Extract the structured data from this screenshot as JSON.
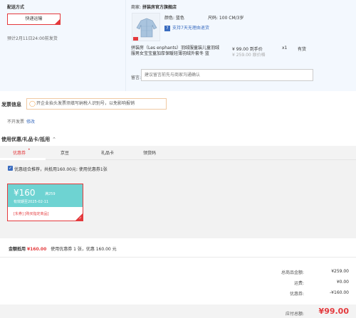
{
  "delivery": {
    "title": "配送方式",
    "method_button": "快递运输",
    "estimate": "预计2月11日24:00前发货"
  },
  "store": {
    "prefix": "商家:",
    "name": "拼装房官方旗舰店"
  },
  "product": {
    "color_label": "颜色: 蓝色",
    "size_label": "尺码: 100 CM/3岁",
    "return_policy": "支持7天无理由退货",
    "name": "拼装房（Les enphants）羽绒服童装儿童羽绒服男女宝宝童加厚保暖轻薄羽绒外套冬 蓝",
    "price": "¥ 99.00 到手价",
    "original_price": "¥ 259.00 原价格",
    "quantity": "x1",
    "stock": "有货",
    "message_label": "留言:",
    "message_placeholder": "建议留言前先与商家沟通确认"
  },
  "invoice": {
    "title": "发票信息",
    "tip": "开企业抬头发票须填写纳税人识别号，以免影响报销",
    "status": "不开发票",
    "edit_link": "修改"
  },
  "coupons": {
    "heading": "使用优惠/礼品卡/抵用",
    "tabs": [
      "优惠券",
      "京豆",
      "礼品卡",
      "领货码"
    ],
    "combo_text": "优惠组合推荐，共抵用160.00元: 使用优惠券1张",
    "card": {
      "amount": "¥160",
      "condition": "满259",
      "expiry": "有效期至2025-02-11",
      "scope": "[东券] [购买指定商品]"
    },
    "summary_prefix": "金额抵用",
    "summary_amount": "¥160.00",
    "summary_suffix": "使用优惠券 1 张，优惠 160.00 元"
  },
  "totals": {
    "rows": [
      {
        "label": "总商品金额:",
        "value": "¥259.00"
      },
      {
        "label": "运费:",
        "value": "¥0.00"
      },
      {
        "label": "优惠券:",
        "value": "-¥160.00"
      }
    ],
    "pay_label": "应付总额:",
    "pay_value": "¥99.00"
  },
  "colors": {
    "accent_red": "#e4393c",
    "link_blue": "#3a6cc0",
    "coupon_teal": "#6ed3d2"
  }
}
